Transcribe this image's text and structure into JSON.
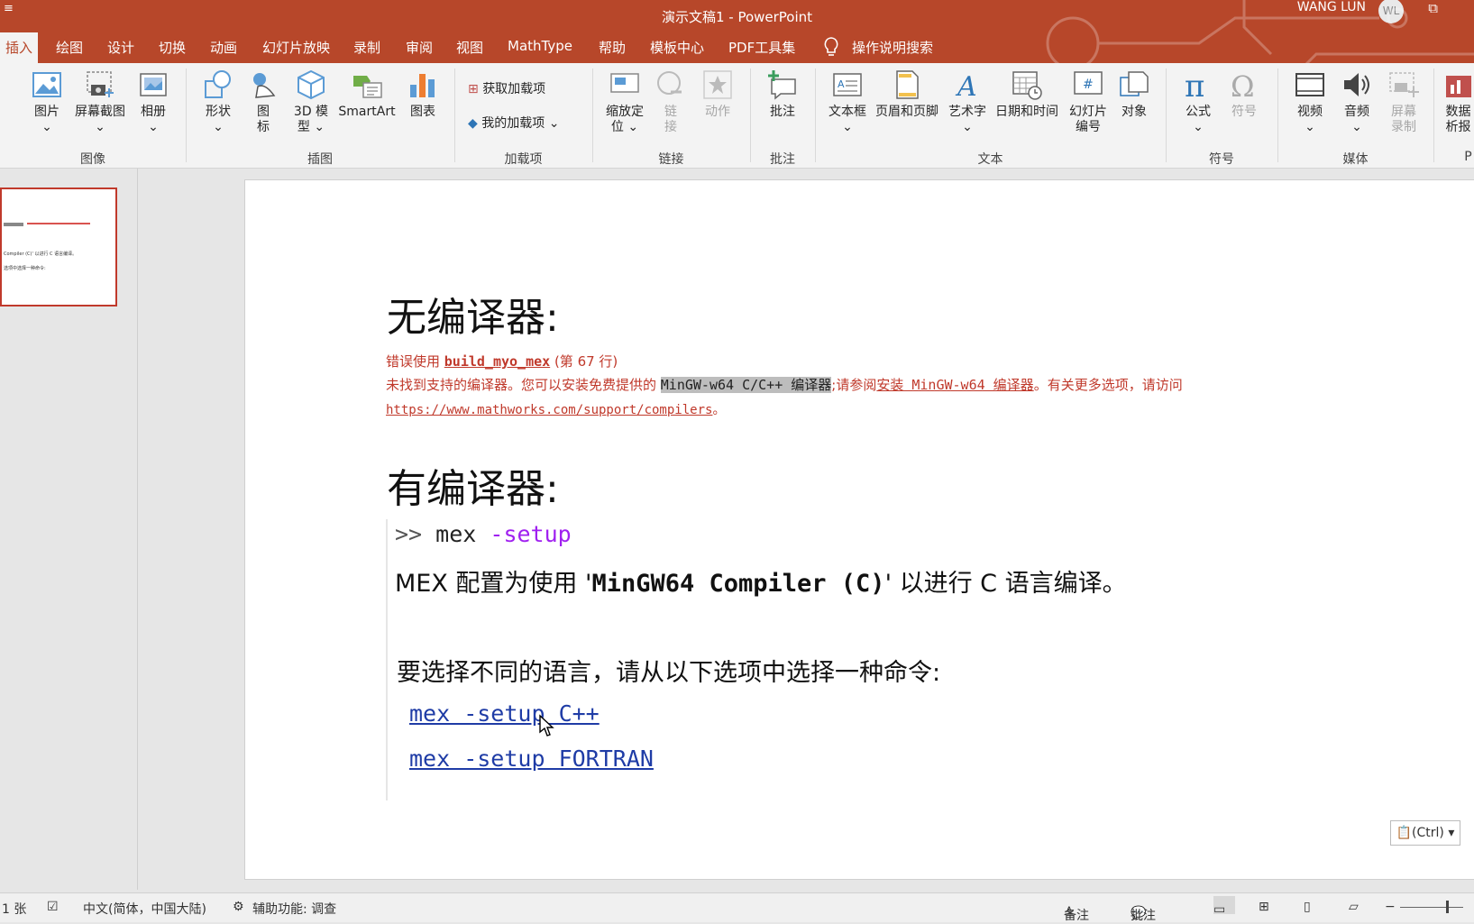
{
  "window": {
    "title": "演示文稿1 - PowerPoint",
    "user": "WANG LUN",
    "avatar": "WL",
    "qat_icon": "≡",
    "restore_icon": "⧉"
  },
  "tabs": [
    "插入",
    "绘图",
    "设计",
    "切换",
    "动画",
    "幻灯片放映",
    "录制",
    "审阅",
    "视图",
    "MathType",
    "帮助",
    "模板中心",
    "PDF工具集",
    "操作说明搜索"
  ],
  "ribbon": {
    "groups": {
      "images": "图像",
      "illustrations": "插图",
      "addins": "加载项",
      "links": "链接",
      "comments": "批注",
      "text": "文本",
      "symbols": "符号",
      "media": "媒体",
      "p": "P"
    },
    "buttons": {
      "picture": "图片",
      "screenshot": "屏幕截图",
      "album": "相册",
      "shapes": "形状",
      "icons_l1": "图",
      "icons_l2": "标",
      "model3d_l1": "3D 模",
      "model3d_l2": "型",
      "smartart": "SmartArt",
      "chart": "图表",
      "get_addins": "获取加载项",
      "my_addins": "我的加载项",
      "zoom_l1": "缩放定",
      "zoom_l2": "位",
      "link_l1": "链",
      "link_l2": "接",
      "action": "动作",
      "comment": "批注",
      "textbox": "文本框",
      "header_footer": "页眉和页脚",
      "wordart": "艺术字",
      "datetime": "日期和时间",
      "slide_no_l1": "幻灯片",
      "slide_no_l2": "编号",
      "object": "对象",
      "equation": "公式",
      "symbol": "符号",
      "video": "视频",
      "audio": "音频",
      "screenrec_l1": "屏幕",
      "screenrec_l2": "录制",
      "data_l1": "数据",
      "data_l2": "析报"
    }
  },
  "thumbnail": {
    "line1": "Compiler (C)' 以进行 C 语言编译。",
    "line2": "选项中选择一种命令:"
  },
  "slide": {
    "heading1": "无编译器:",
    "err_line1_a": "错误使用 ",
    "err_line1_b": "build_myo_mex",
    "err_line1_c": " (第 67 行)",
    "err_line2_a": "未找到支持的编译器。您可以安装免费提供的 ",
    "err_line2_b": "MinGW-w64 C/C++ 编译器",
    "err_line2_c": ";请参阅",
    "err_line2_d": "安装 MinGW-w64 编译器",
    "err_line2_e": "。有关更多选项，请访问",
    "err_line3_a": "https://www.mathworks.com/support/compilers",
    "err_line3_b": "。",
    "heading2": "有编译器:",
    "prompt": ">>",
    "cmd_a": "mex ",
    "cmd_b": "-setup",
    "mex_line_a": "MEX 配置为使用 '",
    "mex_line_b": "MinGW64 Compiler (C)",
    "mex_line_c": "' 以进行 C 语言编译。",
    "choose_line": "要选择不同的语言，请从以下选项中选择一种命令:",
    "link_cpp": "mex -setup C++",
    "link_fortran": "mex -setup FORTRAN",
    "paste_btn": "(Ctrl)"
  },
  "status": {
    "slide_count": "1 张",
    "language": "中文(简体，中国大陆)",
    "accessibility": "辅助功能: 调查",
    "notes": "备注",
    "comments": "批注",
    "zoom_minus": "−"
  }
}
